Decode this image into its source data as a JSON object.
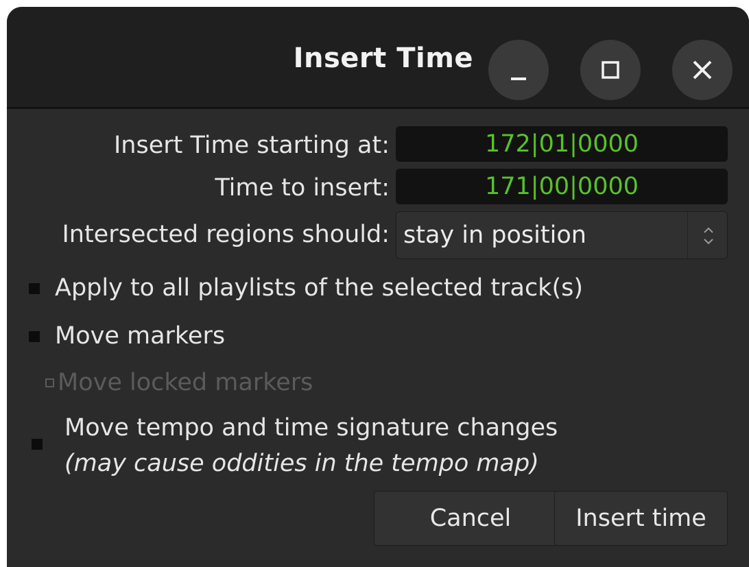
{
  "window": {
    "title": "Insert Time",
    "controls": [
      "minimize-icon",
      "maximize-icon",
      "close-icon"
    ]
  },
  "form": {
    "start_label": "Insert Time starting at:",
    "start_value": "172|01|0000",
    "duration_label": "Time to insert:",
    "duration_value": "171|00|0000",
    "intersect_label": "Intersected regions should:",
    "intersect_value": "stay in position"
  },
  "options": {
    "all_playlists": "Apply to all playlists of the selected track(s)",
    "all_playlists_checked": true,
    "move_markers": "Move markers",
    "move_markers_checked": true,
    "move_locked_markers": "Move locked markers",
    "move_locked_markers_checked": false,
    "move_locked_markers_enabled": false,
    "move_tempo": "Move tempo and time signature changes",
    "move_tempo_note": "(may cause oddities in the tempo map)",
    "move_tempo_checked": true
  },
  "buttons": {
    "cancel": "Cancel",
    "insert": "Insert time"
  },
  "colors": {
    "clock_text": "#58c22a",
    "window_bg": "#2b2b2b",
    "titlebar_bg": "#1f1f1f"
  }
}
